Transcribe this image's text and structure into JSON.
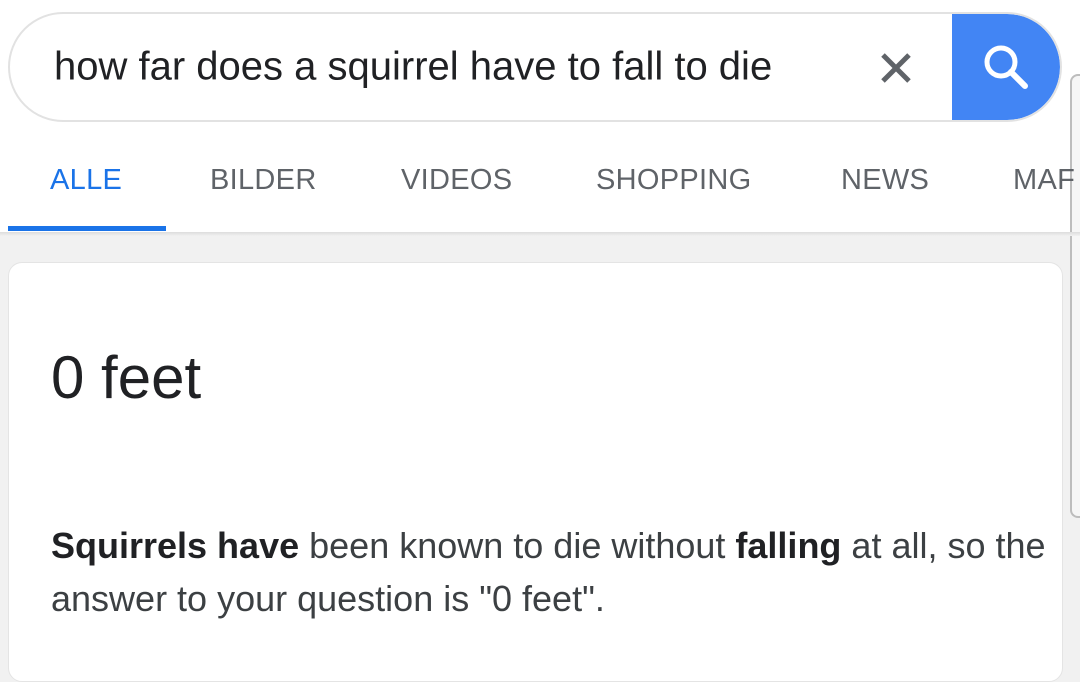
{
  "search": {
    "query": "how far does a squirrel have to fall to die",
    "clear_icon": "close-icon",
    "search_icon": "search-icon",
    "accent_color": "#4285f4"
  },
  "tabs": [
    {
      "label": "ALLE",
      "active": true
    },
    {
      "label": "BILDER",
      "active": false
    },
    {
      "label": "VIDEOS",
      "active": false
    },
    {
      "label": "SHOPPING",
      "active": false
    },
    {
      "label": "NEWS",
      "active": false
    },
    {
      "label": "MAF",
      "active": false
    }
  ],
  "result": {
    "answer": "0 feet",
    "snippet": {
      "bold1": "Squirrels have",
      "text1": " been known to die without ",
      "bold2": "falling",
      "text2": " at all, so the answer to your question is \"0 feet\"."
    }
  }
}
